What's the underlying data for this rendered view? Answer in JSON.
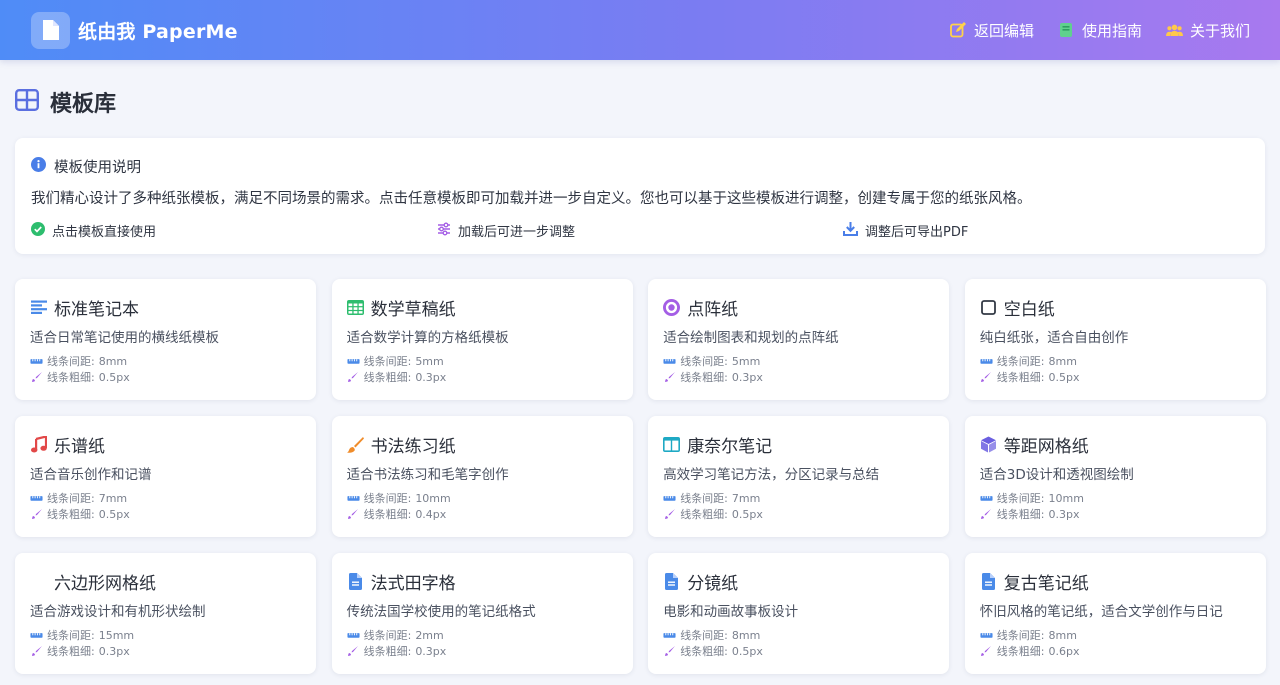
{
  "header": {
    "brand_title": "纸由我 PaperMe",
    "nav": [
      {
        "label": "返回编辑",
        "icon": "edit-icon"
      },
      {
        "label": "使用指南",
        "icon": "book-icon"
      },
      {
        "label": "关于我们",
        "icon": "users-icon"
      }
    ]
  },
  "page": {
    "title": "模板库",
    "title_icon": "grid-icon"
  },
  "info": {
    "heading": "模板使用说明",
    "description": "我们精心设计了多种纸张模板，满足不同场景的需求。点击任意模板即可加载并进一步自定义。您也可以基于这些模板进行调整，创建专属于您的纸张风格。",
    "points": [
      {
        "label": "点击模板直接使用",
        "icon": "check-circle-icon"
      },
      {
        "label": "加载后可进一步调整",
        "icon": "sliders-icon"
      },
      {
        "label": "调整后可导出PDF",
        "icon": "download-icon"
      }
    ]
  },
  "meta_labels": {
    "spacing": "线条间距:",
    "thickness": "线条粗细:"
  },
  "templates": [
    {
      "title": "标准笔记本",
      "desc": "适合日常笔记使用的横线纸模板",
      "spacing": "8mm",
      "thickness": "0.5px",
      "icon": "lines-icon",
      "color": "#4a8ae8"
    },
    {
      "title": "数学草稿纸",
      "desc": "适合数学计算的方格纸模板",
      "spacing": "5mm",
      "thickness": "0.3px",
      "icon": "table-icon",
      "color": "#2dbd6e"
    },
    {
      "title": "点阵纸",
      "desc": "适合绘制图表和规划的点阵纸",
      "spacing": "5mm",
      "thickness": "0.3px",
      "icon": "dot-circle-icon",
      "color": "#a45ee5"
    },
    {
      "title": "空白纸",
      "desc": "纯白纸张，适合自由创作",
      "spacing": "8mm",
      "thickness": "0.5px",
      "icon": "square-icon",
      "color": "#333a46"
    },
    {
      "title": "乐谱纸",
      "desc": "适合音乐创作和记谱",
      "spacing": "7mm",
      "thickness": "0.5px",
      "icon": "music-note-icon",
      "color": "#e24848"
    },
    {
      "title": "书法练习纸",
      "desc": "适合书法练习和毛笔字创作",
      "spacing": "10mm",
      "thickness": "0.4px",
      "icon": "brush-icon",
      "color": "#f08c2a"
    },
    {
      "title": "康奈尔笔记",
      "desc": "高效学习笔记方法，分区记录与总结",
      "spacing": "7mm",
      "thickness": "0.5px",
      "icon": "columns-icon",
      "color": "#1ea9c4"
    },
    {
      "title": "等距网格纸",
      "desc": "适合3D设计和透视图绘制",
      "spacing": "10mm",
      "thickness": "0.3px",
      "icon": "cube-icon",
      "color": "#6b5fe0"
    },
    {
      "title": "六边形网格纸",
      "desc": "适合游戏设计和有机形状绘制",
      "spacing": "15mm",
      "thickness": "0.3px",
      "icon": "none",
      "color": "#333a46"
    },
    {
      "title": "法式田字格",
      "desc": "传统法国学校使用的笔记纸格式",
      "spacing": "2mm",
      "thickness": "0.3px",
      "icon": "file-icon",
      "color": "#4a8ae8"
    },
    {
      "title": "分镜纸",
      "desc": "电影和动画故事板设计",
      "spacing": "8mm",
      "thickness": "0.5px",
      "icon": "file-icon",
      "color": "#4a8ae8"
    },
    {
      "title": "复古笔记纸",
      "desc": "怀旧风格的笔记纸，适合文学创作与日记",
      "spacing": "8mm",
      "thickness": "0.6px",
      "icon": "file-icon",
      "color": "#4a8ae8"
    }
  ]
}
